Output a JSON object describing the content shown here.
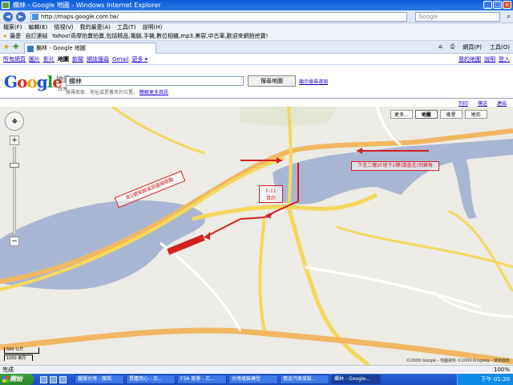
{
  "window": {
    "title": "欄林 - Google 地圖 - Windows Internet Explorer"
  },
  "address": {
    "url": "http://maps.google.com.tw/",
    "search_placeholder": "Google"
  },
  "menu": [
    "檔案(F)",
    "編輯(E)",
    "檢視(V)",
    "我的最愛(A)",
    "工具(T)",
    "說明(H)"
  ],
  "favorites": {
    "label": "最愛",
    "items": [
      "自訂連結",
      "Yahoo!奇摩拍賣拍賣,包括精品,電腦,手機,數位相機,mp3,美容,中古車,歡迎來網拍挖寶!"
    ]
  },
  "tab": {
    "label": "欄林 - Google 地圖"
  },
  "tools": {
    "page": "網頁(P)",
    "tools": "工具(O)"
  },
  "services": {
    "left": [
      "所有網頁",
      "圖片",
      "影片",
      "地圖",
      "新聞",
      "網誌搜尋",
      "Gmail",
      "更多 ▾"
    ],
    "active": "地圖",
    "right": [
      "我的地圖",
      "說明",
      "登入"
    ]
  },
  "search": {
    "logo_sub": "地圖",
    "logo_region": "台灣",
    "query": "欄林",
    "button": "搜尋地圖",
    "options_link": "顯示搜尋選項",
    "hint": "搜尋商家、地址或是著名的位置。",
    "hint_link": "瞭解更多資訊"
  },
  "map_links": {
    "print": "列印",
    "send": "傳送",
    "link": "連結"
  },
  "map_types": {
    "more": "更多...",
    "map": "地圖",
    "satellite": "衛星",
    "terrain": "地形"
  },
  "annotations": {
    "left_note": "走1號穿越溪洞邊緣移動",
    "right_note": "下走二樓2F地下2樓(請直走)到轉角",
    "marker_code": "F-11",
    "marker_label": "目的"
  },
  "scale": {
    "metric": "500 公尺",
    "imperial": "1000 英尺"
  },
  "copyright": "©2009 Google - 地圖資料 ©2009 Kingway - 使用條款",
  "status": {
    "left": "完成",
    "zoom": "100%"
  },
  "taskbar": {
    "start": "開始",
    "items": [
      "趣聞台灣 - 摩羯",
      "異體用心 - 另...",
      "F3A 美學 - 乙...",
      "台灣搖裝模型",
      "懷念汽車放鬆...",
      "欄林 - Google..."
    ],
    "active_index": 5,
    "clock": "下午 01:20"
  },
  "colors": {
    "water": "#a9b6d3",
    "road_major": "#f5d85a",
    "road_highway": "#f0b860",
    "route_arrow": "#d62020",
    "land": "#ecebe5"
  }
}
